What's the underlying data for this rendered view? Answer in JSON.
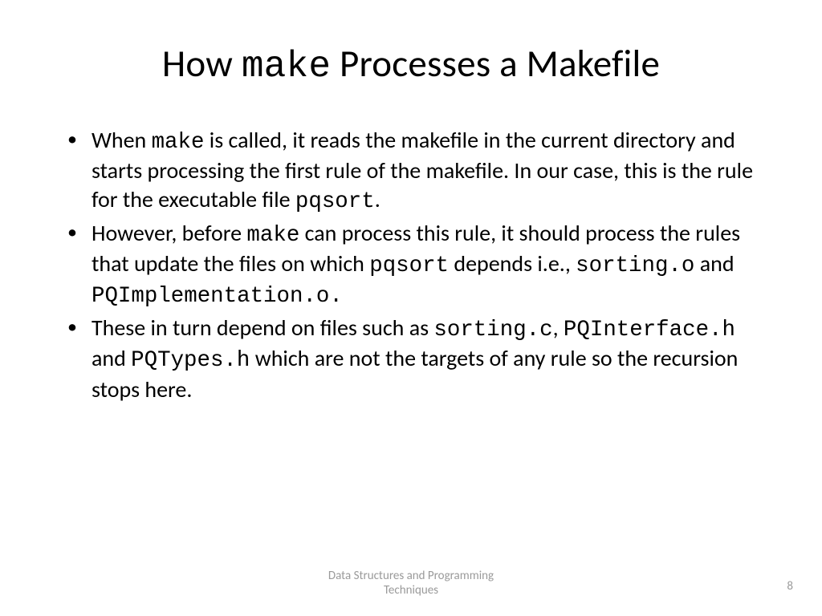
{
  "title": {
    "part1": "How ",
    "code1": "make",
    "part2": " Processes a Makefile"
  },
  "bullets": [
    {
      "segments": [
        {
          "t": "When ",
          "mono": false
        },
        {
          "t": "make",
          "mono": true
        },
        {
          "t": " is called, it reads the makefile in the current directory and starts processing the first rule of the makefile. In our case, this is the rule for the executable file ",
          "mono": false
        },
        {
          "t": "pqsort",
          "mono": true
        },
        {
          "t": ".",
          "mono": false
        }
      ]
    },
    {
      "segments": [
        {
          "t": "However, before ",
          "mono": false
        },
        {
          "t": "make",
          "mono": true
        },
        {
          "t": " can process this rule, it should process the rules that update the files on which ",
          "mono": false
        },
        {
          "t": "pqsort",
          "mono": true
        },
        {
          "t": " depends i.e., ",
          "mono": false
        },
        {
          "t": "sorting.o",
          "mono": true
        },
        {
          "t": " and ",
          "mono": false
        },
        {
          "t": "PQImplementation.o.",
          "mono": true
        }
      ]
    },
    {
      "segments": [
        {
          "t": "These in turn depend on files such as ",
          "mono": false
        },
        {
          "t": "sorting.c",
          "mono": true
        },
        {
          "t": ", ",
          "mono": false
        },
        {
          "t": "PQInterface.h",
          "mono": true
        },
        {
          "t": " and ",
          "mono": false
        },
        {
          "t": "PQTypes.h",
          "mono": true
        },
        {
          "t": " which are not the targets of any rule so the recursion stops here.",
          "mono": false
        }
      ]
    }
  ],
  "footer": {
    "line1": "Data Structures and Programming",
    "line2": "Techniques"
  },
  "page_number": "8"
}
